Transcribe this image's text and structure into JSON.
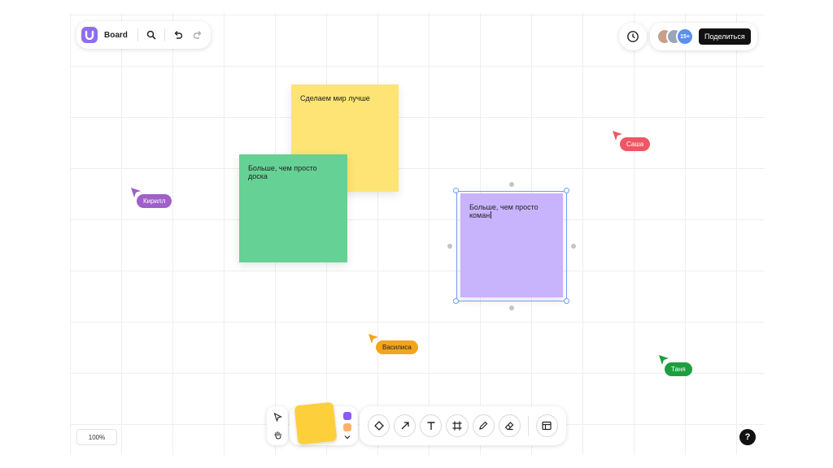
{
  "header": {
    "board_title": "Board"
  },
  "collab": {
    "more_count": "15+",
    "share_label": "Поделиться"
  },
  "notes": {
    "yellow": "Сделаем мир лучше",
    "green": "Больше, чем просто доска",
    "purple": "Больше, чем просто коман"
  },
  "cursors": {
    "kirill": "Кирилл",
    "sasha": "Саша",
    "vasilisa": "Василиса",
    "tanya": "Таня"
  },
  "footer": {
    "zoom": "100%",
    "help": "?"
  },
  "colors": {
    "accent": "#8e6ef0",
    "note_yellow": "#fde474",
    "note_green": "#66d194",
    "note_purple": "#c8b3fd",
    "cursor_kirill": "#a05fc9",
    "cursor_sasha": "#ef5664",
    "cursor_vasilisa": "#f2a51b",
    "cursor_tanya": "#1f9e3e",
    "swatch_purple": "#8c5cf6",
    "swatch_orange": "#fbb36b"
  },
  "icons": [
    "search-icon",
    "undo-icon",
    "redo-icon",
    "clock-icon",
    "pointer-icon",
    "hand-icon",
    "shape-icon",
    "arrow-icon",
    "text-icon",
    "frame-icon",
    "pen-icon",
    "eraser-icon",
    "template-icon",
    "chevron-down-icon"
  ]
}
